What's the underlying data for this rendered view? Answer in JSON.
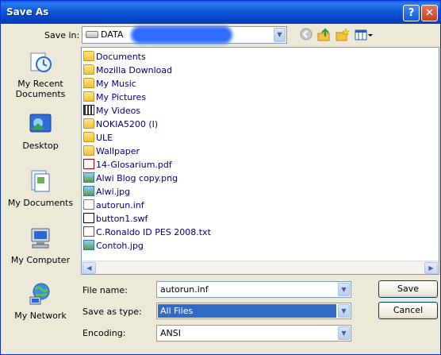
{
  "window": {
    "title": "Save As",
    "help_label": "?",
    "close_label": "✕"
  },
  "save_in": {
    "label": "Save in:",
    "value": "DATA"
  },
  "toolbar": {
    "icons": [
      "back-icon",
      "up-folder-icon",
      "new-folder-icon",
      "views-menu-icon"
    ]
  },
  "places": [
    {
      "label": "My Recent Documents",
      "icon": "recent-documents-icon"
    },
    {
      "label": "Desktop",
      "icon": "desktop-icon"
    },
    {
      "label": "My Documents",
      "icon": "my-documents-icon"
    },
    {
      "label": "My Computer",
      "icon": "my-computer-icon"
    },
    {
      "label": "My Network",
      "icon": "my-network-icon"
    }
  ],
  "files": [
    {
      "name": "Documents",
      "type": "folder"
    },
    {
      "name": "Mozilla Download",
      "type": "folder"
    },
    {
      "name": "My Music",
      "type": "folder"
    },
    {
      "name": "My Pictures",
      "type": "folder"
    },
    {
      "name": "My Videos",
      "type": "video-folder"
    },
    {
      "name": "NOKIA5200 (I)",
      "type": "folder"
    },
    {
      "name": "ULE",
      "type": "folder"
    },
    {
      "name": "Wallpaper",
      "type": "folder"
    },
    {
      "name": "14-Glosarium.pdf",
      "type": "pdf"
    },
    {
      "name": "Alwi Blog copy.png",
      "type": "image"
    },
    {
      "name": "Alwi.jpg",
      "type": "image"
    },
    {
      "name": "autorun.inf",
      "type": "settings"
    },
    {
      "name": "button1.swf",
      "type": "swf"
    },
    {
      "name": "C.Ronaldo ID PES 2008.txt",
      "type": "text"
    },
    {
      "name": "Contoh.jpg",
      "type": "image"
    }
  ],
  "file_name": {
    "label": "File name:",
    "value": "autorun.inf"
  },
  "save_as_type": {
    "label": "Save as type:",
    "value": "All Files"
  },
  "encoding": {
    "label": "Encoding:",
    "value": "ANSI"
  },
  "buttons": {
    "save": "Save",
    "cancel": "Cancel"
  }
}
